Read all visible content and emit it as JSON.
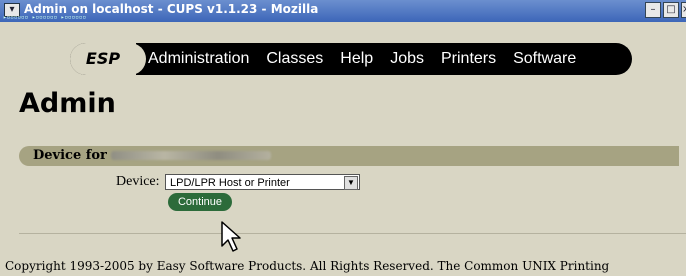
{
  "window": {
    "title": "Admin on localhost - CUPS v1.1.23 - Mozilla",
    "minimize_glyph": "–",
    "maximize_glyph": "□",
    "close_glyph": "×"
  },
  "nav": {
    "esp": "ESP",
    "items": [
      "Administration",
      "Classes",
      "Help",
      "Jobs",
      "Printers",
      "Software"
    ]
  },
  "page": {
    "title": "Admin",
    "device_for_label": "Device for",
    "device_label": "Device:",
    "device_selected": "LPD/LPR Host or Printer",
    "continue_label": "Continue",
    "footer": "Copyright 1993-2005 by Easy Software Products. All Rights Reserved. The Common UNIX Printing"
  },
  "colors": {
    "background": "#d9d6c4",
    "device_bar": "#a6a382",
    "continue_button": "#2c6b3a",
    "titlebar": "#3d66b8"
  }
}
